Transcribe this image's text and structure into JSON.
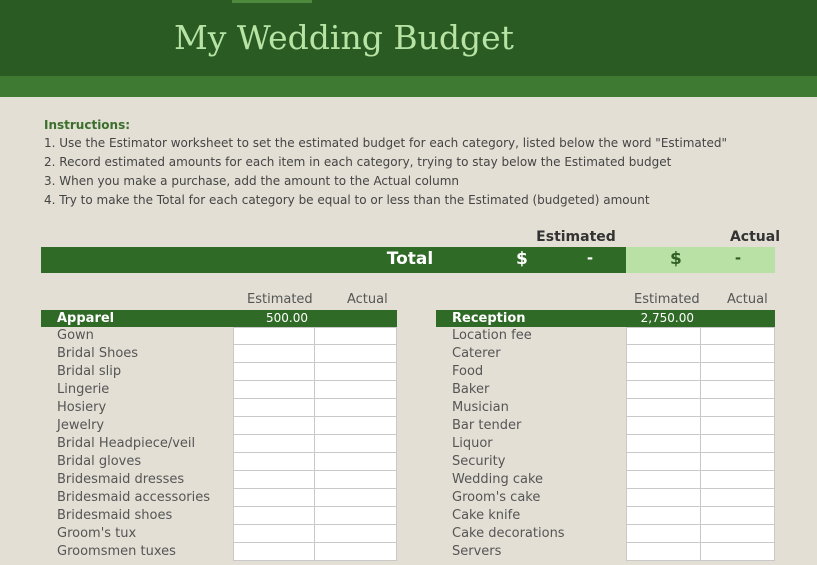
{
  "header": {
    "title": "My Wedding Budget"
  },
  "instructions": {
    "heading": "Instructions:",
    "lines": [
      "1. Use the Estimator worksheet to set the estimated budget for each category, listed below the word \"Estimated\"",
      "2. Record estimated amounts for each item in each category, trying to stay below the Estimated budget",
      "3. When you make a purchase, add the amount to the Actual column",
      "4. Try to make the Total for each category be equal to or less than the Estimated (budgeted) amount"
    ]
  },
  "totals": {
    "estimated_label": "Estimated",
    "actual_label": "Actual",
    "row_label": "Total",
    "estimated_currency": "$",
    "estimated_value": "-",
    "actual_currency": "$",
    "actual_value": "-"
  },
  "apparel": {
    "estimated_header": "Estimated",
    "actual_header": "Actual",
    "name": "Apparel",
    "estimated_value": "500.00",
    "items": [
      "Gown",
      "Bridal Shoes",
      "Bridal slip",
      "Lingerie",
      "Hosiery",
      "Jewelry",
      "Bridal Headpiece/veil",
      "Bridal gloves",
      "Bridesmaid dresses",
      "Bridesmaid accessories",
      "Bridesmaid shoes",
      "Groom's tux",
      "Groomsmen tuxes"
    ]
  },
  "reception": {
    "estimated_header": "Estimated",
    "actual_header": "Actual",
    "name": "Reception",
    "estimated_value": "2,750.00",
    "items": [
      "Location fee",
      "Caterer",
      "Food",
      "Baker",
      "Musician",
      "Bar tender",
      "Liquor",
      "Security",
      "Wedding cake",
      "Groom's cake",
      "Cake knife",
      "Cake decorations",
      "Servers"
    ]
  },
  "colors": {
    "banner": "#2a5b23",
    "banner_strip": "#3e7a31",
    "title_text": "#b7e3a4",
    "section_bar": "#2f6a26",
    "actual_total_fill": "#b9e0a5",
    "background": "#e3dfd5"
  }
}
